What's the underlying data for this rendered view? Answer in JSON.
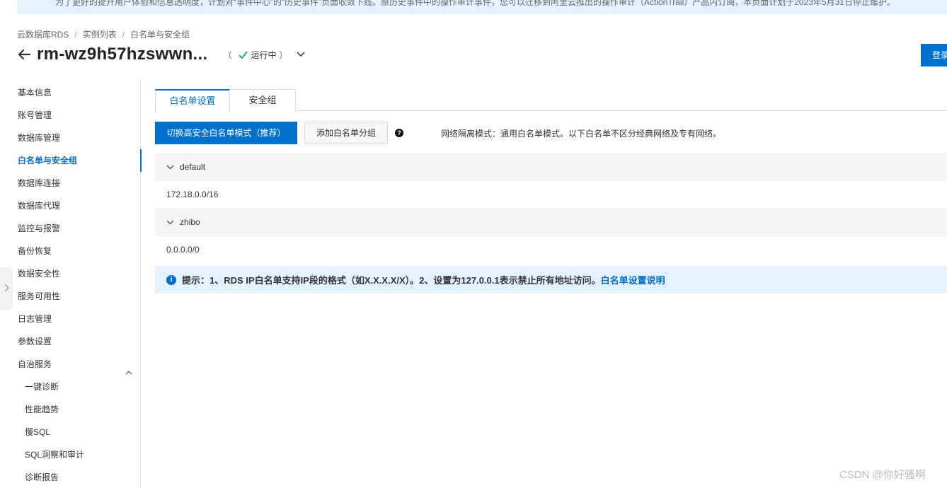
{
  "notice": {
    "text": "为了更好的提升用户体验和信息透明度，计划对“事件中心”的“历史事件”页面收敛下线。原历史事件中的操作审计事件，您可以迁移到阿里云推出的操作审计（ActionTrail）产品内订阅，本页面计划于2023年5月31日停止维护。"
  },
  "breadcrumb": {
    "items": [
      "云数据库RDS",
      "实例列表",
      "白名单与安全组"
    ],
    "separator": "/"
  },
  "header": {
    "title": "rm-wz9h57hzswwn...",
    "status_open": "（",
    "status_label": "运行中",
    "status_close": "）",
    "status_color": "#00a854",
    "login_label": "登录数据库"
  },
  "sidebar": {
    "items": [
      {
        "label": "基本信息"
      },
      {
        "label": "账号管理"
      },
      {
        "label": "数据库管理"
      },
      {
        "label": "白名单与安全组",
        "active": true
      },
      {
        "label": "数据库连接"
      },
      {
        "label": "数据库代理"
      },
      {
        "label": "监控与报警"
      },
      {
        "label": "备份恢复"
      },
      {
        "label": "数据安全性"
      },
      {
        "label": "服务可用性"
      },
      {
        "label": "日志管理"
      },
      {
        "label": "参数设置"
      },
      {
        "label": "自治服务",
        "expanded": true
      }
    ],
    "sub_items": [
      {
        "label": "一键诊断"
      },
      {
        "label": "性能趋势"
      },
      {
        "label": "慢SQL"
      },
      {
        "label": "SQL洞察和审计"
      },
      {
        "label": "诊断报告"
      }
    ]
  },
  "tabs": [
    {
      "label": "白名单设置",
      "active": true
    },
    {
      "label": "安全组"
    }
  ],
  "toolbar": {
    "switch_mode_label": "切换高安全白名单模式（推荐）",
    "add_group_label": "添加白名单分组",
    "help_icon": "?",
    "network_mode_text": "网络隔离模式：通用白名单模式。以下白名单不区分经典网络及专有网络。"
  },
  "whitelist_groups": [
    {
      "name": "default",
      "ips": "172.18.0.0/16"
    },
    {
      "name": "zhibo",
      "ips": "0.0.0.0/0"
    }
  ],
  "tip": {
    "icon": "i",
    "text": "提示：1、RDS IP白名单支持IP段的格式（如X.X.X.X/X）。2、设置为127.0.0.1表示禁止所有地址访问。",
    "link_label": "白名单设置说明"
  },
  "watermark": "CSDN @你好骚啊",
  "colors": {
    "accent": "#0070cc",
    "notice_bg": "#e4f2ff",
    "group_bg": "#f5f5f5",
    "status_ok": "#00a854"
  }
}
